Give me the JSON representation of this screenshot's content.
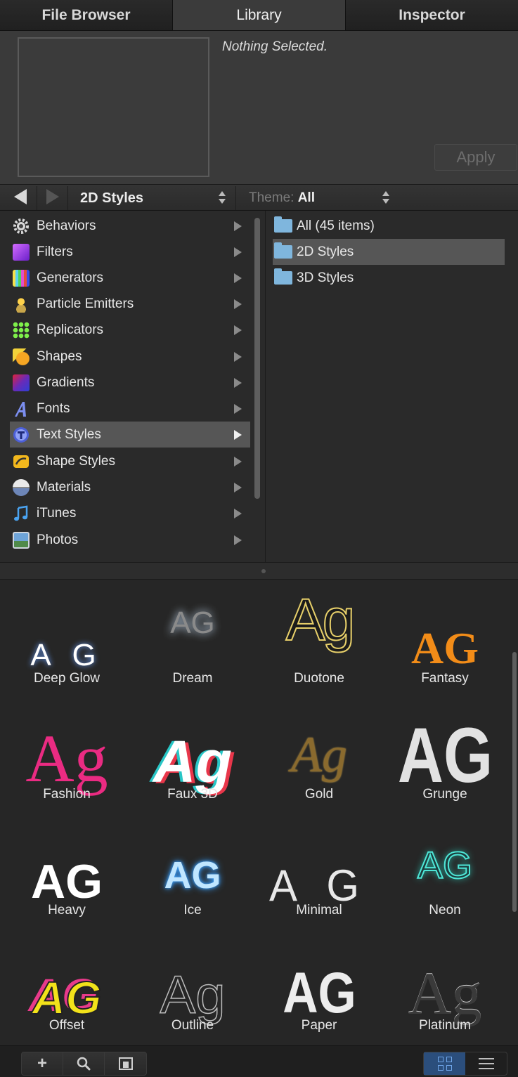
{
  "tabs": [
    {
      "label": "File Browser",
      "active": false
    },
    {
      "label": "Library",
      "active": true
    },
    {
      "label": "Inspector",
      "active": false
    }
  ],
  "preview": {
    "status": "Nothing Selected.",
    "apply_label": "Apply"
  },
  "navbar": {
    "location": "2D Styles",
    "theme_prefix": "Theme:",
    "theme_value": "All"
  },
  "categories": [
    {
      "label": "Behaviors",
      "icon": "gear-icon"
    },
    {
      "label": "Filters",
      "icon": "filters-icon"
    },
    {
      "label": "Generators",
      "icon": "generators-icon"
    },
    {
      "label": "Particle Emitters",
      "icon": "particle-emitters-icon"
    },
    {
      "label": "Replicators",
      "icon": "replicators-icon"
    },
    {
      "label": "Shapes",
      "icon": "shapes-icon"
    },
    {
      "label": "Gradients",
      "icon": "gradients-icon"
    },
    {
      "label": "Fonts",
      "icon": "fonts-icon"
    },
    {
      "label": "Text Styles",
      "icon": "text-styles-icon",
      "selected": true
    },
    {
      "label": "Shape Styles",
      "icon": "shape-styles-icon"
    },
    {
      "label": "Materials",
      "icon": "materials-icon"
    },
    {
      "label": "iTunes",
      "icon": "music-note-icon"
    },
    {
      "label": "Photos",
      "icon": "photos-icon"
    }
  ],
  "folders": [
    {
      "label": "All (45 items)"
    },
    {
      "label": "2D Styles",
      "selected": true
    },
    {
      "label": "3D Styles"
    }
  ],
  "styles": [
    {
      "label": "Deep Glow",
      "sample": "A G"
    },
    {
      "label": "Dream",
      "sample": "AG"
    },
    {
      "label": "Duotone",
      "sample": "Ag"
    },
    {
      "label": "Fantasy",
      "sample": "AG"
    },
    {
      "label": "Fashion",
      "sample": "Ag"
    },
    {
      "label": "Faux 3D",
      "sample": "Ag"
    },
    {
      "label": "Gold",
      "sample": "Ag"
    },
    {
      "label": "Grunge",
      "sample": "AG"
    },
    {
      "label": "Heavy",
      "sample": "AG"
    },
    {
      "label": "Ice",
      "sample": "AG"
    },
    {
      "label": "Minimal",
      "sample": "A G"
    },
    {
      "label": "Neon",
      "sample": "AG"
    },
    {
      "label": "Offset",
      "sample": "AG"
    },
    {
      "label": "Outline",
      "sample": "Ag"
    },
    {
      "label": "Paper",
      "sample": "AG"
    },
    {
      "label": "Platinum",
      "sample": "Ag"
    }
  ],
  "bottombar": {
    "add_symbol": "+",
    "view_mode": "grid"
  },
  "colors": {
    "selection": "#565656",
    "folder": "#7fb6dd",
    "active_view": "#2b4e7c"
  }
}
